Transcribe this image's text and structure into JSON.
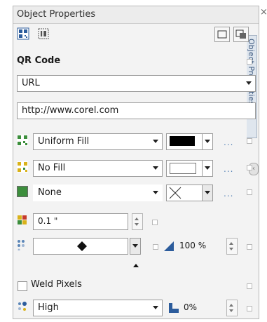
{
  "window": {
    "title": "Object Properties",
    "side_tab": "Object Properties"
  },
  "section": {
    "title": "QR Code"
  },
  "type_dropdown": {
    "value": "URL"
  },
  "url_field": {
    "value": "http://www.corel.com"
  },
  "fill_rows": [
    {
      "value": "Uniform Fill",
      "swatch_color": "#000000",
      "more": "..."
    },
    {
      "value": "No Fill",
      "swatch_color": "#ffffff",
      "more": "..."
    },
    {
      "value": "None",
      "more": "..."
    }
  ],
  "outline_width": {
    "value": "0.1 \""
  },
  "pattern_row": {
    "opacity": "100 %"
  },
  "weld": {
    "label": "Weld Pixels"
  },
  "quality_row": {
    "value": "High",
    "percent": "0%"
  },
  "colors": {
    "green": "#3c8e3c",
    "yellow": "#d9b21a",
    "accent_blue": "#5b86b8"
  }
}
